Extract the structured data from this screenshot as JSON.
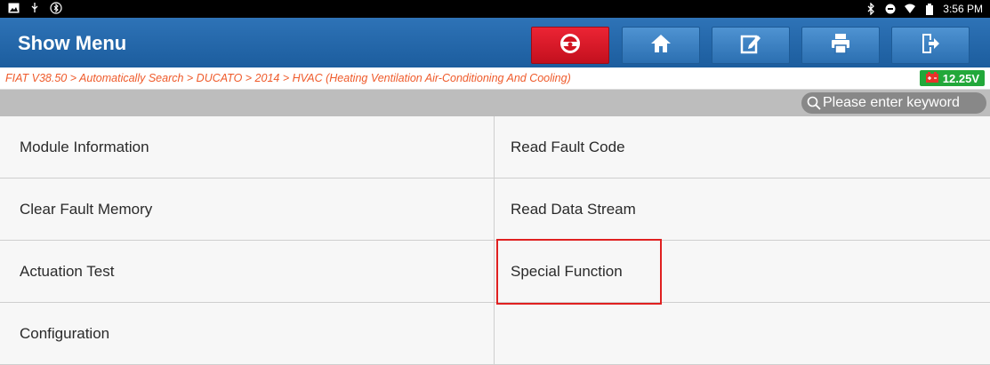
{
  "status": {
    "time": "3:56 PM"
  },
  "header": {
    "title": "Show Menu",
    "buttons": [
      {
        "icon": "steering-wheel-icon"
      },
      {
        "icon": "home-icon"
      },
      {
        "icon": "edit-report-icon"
      },
      {
        "icon": "printer-icon"
      },
      {
        "icon": "exit-icon"
      }
    ]
  },
  "breadcrumb": "FIAT V38.50 > Automatically Search > DUCATO > 2014 > HVAC (Heating Ventilation Air-Conditioning And Cooling)",
  "voltage": "12.25V",
  "search": {
    "placeholder": "Please enter keyword"
  },
  "menu": {
    "items": [
      "Module Information",
      "Read Fault Code",
      "Clear Fault Memory",
      "Read Data Stream",
      "Actuation Test",
      "Special Function",
      "Configuration"
    ]
  },
  "colors": {
    "header": "#1c5d9e",
    "breadcrumb": "#ef5a2a",
    "voltage": "#22a83a",
    "highlight": "#e02020"
  }
}
